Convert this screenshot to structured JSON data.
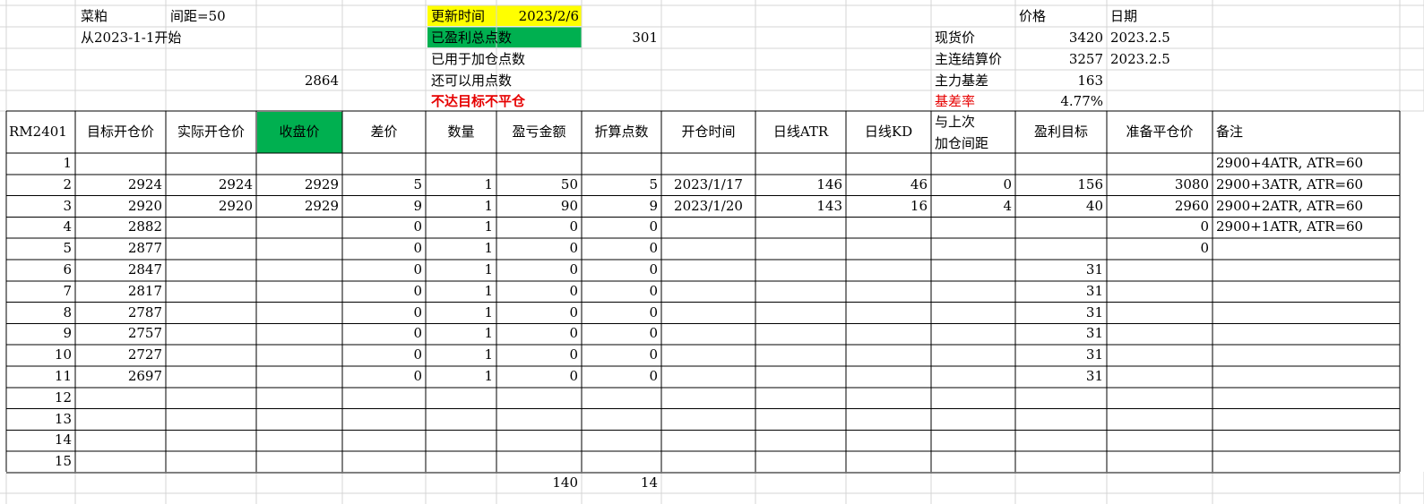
{
  "colors": {
    "gridline": "#d4d4d4",
    "border": "#000000",
    "highlight_yellow": "#ffff00",
    "highlight_green": "#00b050",
    "warn_red": "#e60000"
  },
  "info": {
    "commodity": "菜粕",
    "spacing": "间距=50",
    "start_from": "从2023-1-1开始",
    "value_2864": "2864",
    "update_label": "更新时间",
    "update_date": "2023/2/6",
    "total_profit_label": "已盈利总点数",
    "total_profit_value": "301",
    "used_label": "已用于加仓点数",
    "remaining_label": "还可以用点数",
    "warning": "不达目标不平仓",
    "price_header": "价格",
    "date_header": "日期",
    "spot_label": "现货价",
    "spot_value": "3420",
    "spot_date": "2023.2.5",
    "main_settle_label": "主连结算价",
    "main_settle_value": "3257",
    "main_settle_date": "2023.2.5",
    "basis_label": "主力基差",
    "basis_value": "163",
    "basis_rate_label": "基差率",
    "basis_rate_value": "4.77%"
  },
  "table": {
    "headers": [
      "RM2401",
      "目标开仓价",
      "实际开仓价",
      "收盘价",
      "差价",
      "数量",
      "盈亏金额",
      "折算点数",
      "开仓时间",
      "日线ATR",
      "日线KD",
      "与上次",
      "加仓间距",
      "盈利目标",
      "准备平仓价",
      "备注"
    ],
    "rows": [
      [
        "1",
        "",
        "",
        "",
        "",
        "",
        "",
        "",
        "",
        "",
        "",
        "",
        "",
        "",
        "2900+4ATR,  ATR=60"
      ],
      [
        "2",
        "2924",
        "2924",
        "2929",
        "5",
        "1",
        "50",
        "5",
        "2023/1/17",
        "146",
        "46",
        "0",
        "156",
        "3080",
        "2900+3ATR,  ATR=60"
      ],
      [
        "3",
        "2920",
        "2920",
        "2929",
        "9",
        "1",
        "90",
        "9",
        "2023/1/20",
        "143",
        "16",
        "4",
        "40",
        "2960",
        "2900+2ATR,  ATR=60"
      ],
      [
        "4",
        "2882",
        "",
        "",
        "0",
        "1",
        "0",
        "0",
        "",
        "",
        "",
        "",
        "",
        "0",
        "2900+1ATR,  ATR=60"
      ],
      [
        "5",
        "2877",
        "",
        "",
        "0",
        "1",
        "0",
        "0",
        "",
        "",
        "",
        "",
        "",
        "0",
        ""
      ],
      [
        "6",
        "2847",
        "",
        "",
        "0",
        "1",
        "0",
        "0",
        "",
        "",
        "",
        "",
        "31",
        "",
        ""
      ],
      [
        "7",
        "2817",
        "",
        "",
        "0",
        "1",
        "0",
        "0",
        "",
        "",
        "",
        "",
        "31",
        "",
        ""
      ],
      [
        "8",
        "2787",
        "",
        "",
        "0",
        "1",
        "0",
        "0",
        "",
        "",
        "",
        "",
        "31",
        "",
        ""
      ],
      [
        "9",
        "2757",
        "",
        "",
        "0",
        "1",
        "0",
        "0",
        "",
        "",
        "",
        "",
        "31",
        "",
        ""
      ],
      [
        "10",
        "2727",
        "",
        "",
        "0",
        "1",
        "0",
        "0",
        "",
        "",
        "",
        "",
        "31",
        "",
        ""
      ],
      [
        "11",
        "2697",
        "",
        "",
        "0",
        "1",
        "0",
        "0",
        "",
        "",
        "",
        "",
        "31",
        "",
        ""
      ],
      [
        "12",
        "",
        "",
        "",
        "",
        "",
        "",
        "",
        "",
        "",
        "",
        "",
        "",
        "",
        ""
      ],
      [
        "13",
        "",
        "",
        "",
        "",
        "",
        "",
        "",
        "",
        "",
        "",
        "",
        "",
        "",
        ""
      ],
      [
        "14",
        "",
        "",
        "",
        "",
        "",
        "",
        "",
        "",
        "",
        "",
        "",
        "",
        "",
        ""
      ],
      [
        "15",
        "",
        "",
        "",
        "",
        "",
        "",
        "",
        "",
        "",
        "",
        "",
        "",
        "",
        ""
      ]
    ],
    "totals": {
      "amount": "140",
      "points": "14"
    }
  }
}
